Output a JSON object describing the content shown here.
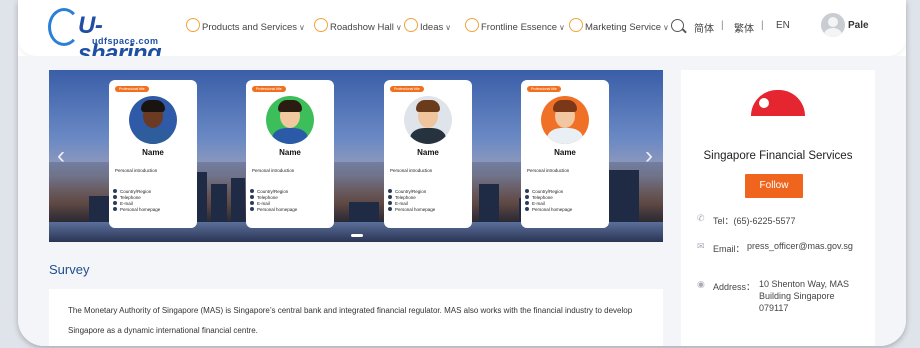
{
  "logo": {
    "brand": "U-sharing",
    "sub": "udfspace.com"
  },
  "nav": {
    "items": [
      {
        "label": "Products and Services",
        "icon": "products-icon",
        "chevron": "∨"
      },
      {
        "label": "Roadshow Hall",
        "icon": "roadshow-icon",
        "chevron": "∨"
      },
      {
        "label": "Ideas",
        "icon": "ideas-icon",
        "chevron": "∨"
      },
      {
        "label": "Frontline Essence",
        "icon": "essence-icon",
        "chevron": "∨"
      },
      {
        "label": "Marketing Service",
        "icon": "marketing-icon",
        "chevron": "∨"
      }
    ],
    "lang": {
      "simplified": "简体",
      "traditional": "繁体",
      "english": "EN",
      "separator": "|"
    },
    "user": {
      "name": "Pale"
    }
  },
  "banner": {
    "prev_arrow": "‹",
    "next_arrow": "›",
    "cards": [
      {
        "tag": "Professional title",
        "name": "Name",
        "intro": "Personal introduction",
        "fields": [
          "Country/Region",
          "Telephone",
          "E-mail",
          "Personal homepage"
        ],
        "photo_bg": "#2f5aa8",
        "skin": "#6b3a22",
        "hair": "#1a1410",
        "shirt": "#2d5d9a"
      },
      {
        "tag": "Professional title",
        "name": "Name",
        "intro": "Personal introduction",
        "fields": [
          "Country/Region",
          "Telephone",
          "E-mail",
          "Personal homepage"
        ],
        "photo_bg": "#3cbf5a",
        "skin": "#f2c8a0",
        "hair": "#2a1c10",
        "shirt": "#2a5aa8"
      },
      {
        "tag": "Professional title",
        "name": "Name",
        "intro": "Personal introduction",
        "fields": [
          "Country/Region",
          "Telephone",
          "E-mail",
          "Personal homepage"
        ],
        "photo_bg": "#dfe4ea",
        "skin": "#f0c49c",
        "hair": "#6a3c1c",
        "shirt": "#26323e"
      },
      {
        "tag": "Professional title",
        "name": "Name",
        "intro": "Personal introduction",
        "fields": [
          "Country/Region",
          "Telephone",
          "E-mail",
          "Personal homepage"
        ],
        "photo_bg": "#f07028",
        "skin": "#f2c6a0",
        "hair": "#7a3818",
        "shirt": "#e8f0f6"
      }
    ]
  },
  "survey": {
    "title": "Survey",
    "text": "The Monetary Authority of Singapore (MAS) is Singapore’s central bank and integrated financial regulator. MAS also works with the financial industry to develop Singapore as a dynamic international financial centre."
  },
  "side": {
    "org_name": "Singapore Financial Services",
    "follow_label": "Follow",
    "tel_label": "Tel：",
    "tel_value": "(65)-6225-5577",
    "email_label": "Email：",
    "email_value": "press_officer@mas.gov.sg",
    "address_label": "Address：",
    "address_value": "10 Shenton Way, MAS Building Singapore 079117"
  },
  "colors": {
    "brand": "#1f4fa5",
    "accent": "#f0651e",
    "title_blue": "#1f4f8f"
  }
}
